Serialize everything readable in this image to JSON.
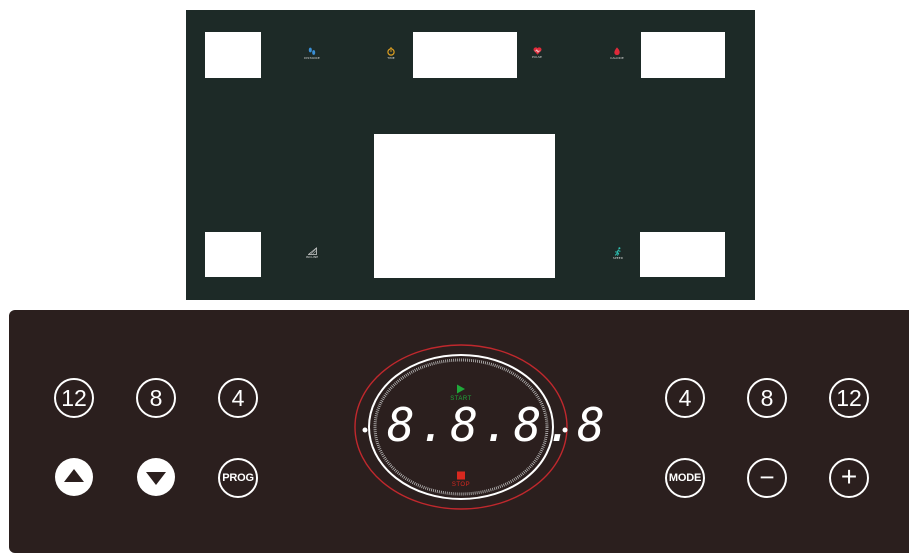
{
  "display_panel": {
    "indicators": {
      "distance": {
        "label": "DISTANCE",
        "icon": "footprints-icon",
        "color": "#3a8fd6"
      },
      "time": {
        "label": "TIME",
        "icon": "stopwatch-icon",
        "color": "#e0a020"
      },
      "pulse": {
        "label": "PULSE",
        "icon": "heart-icon",
        "color": "#e02a3a"
      },
      "calorie": {
        "label": "CALORIE",
        "icon": "flame-icon",
        "color": "#e02a3a"
      },
      "incline": {
        "label": "INCLINE",
        "icon": "incline-icon",
        "color": "#cfcfcf"
      },
      "speed": {
        "label": "SPEED",
        "icon": "runner-icon",
        "color": "#2ec4b6"
      }
    }
  },
  "console": {
    "left_quick_keys": [
      "12",
      "8",
      "4"
    ],
    "right_quick_keys": [
      "4",
      "8",
      "12"
    ],
    "prog_label": "PROG",
    "mode_label": "MODE",
    "minus_symbol": "−",
    "plus_symbol": "+",
    "center_dial": {
      "start_label": "START",
      "stop_label": "STOP",
      "readout": "8.8.8.8",
      "ring_color": "#c0282d",
      "start_color": "#1fa83a",
      "stop_color": "#d8281f"
    }
  }
}
